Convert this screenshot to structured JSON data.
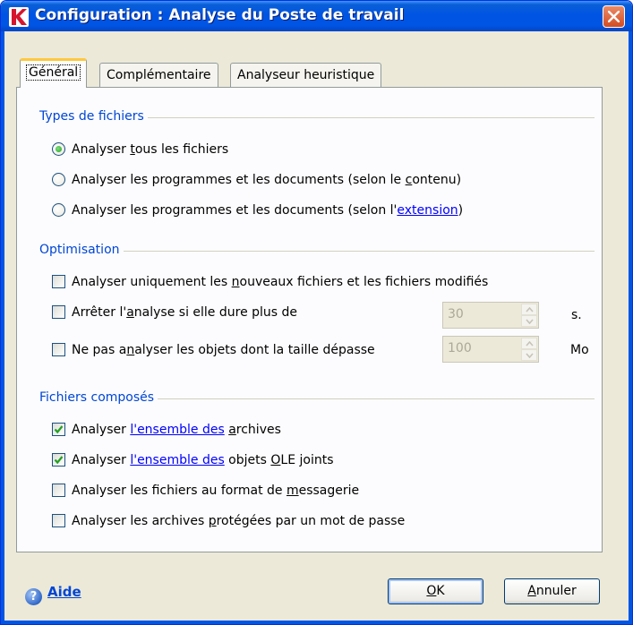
{
  "window": {
    "title": "Configuration : Analyse du Poste de travail",
    "app_icon": "kaspersky-k-icon",
    "close_icon": "close-x-icon"
  },
  "tabs": [
    {
      "label": "Général",
      "active": true
    },
    {
      "label": "Complémentaire",
      "active": false
    },
    {
      "label": "Analyseur heuristique",
      "active": false
    }
  ],
  "file_types": {
    "title": "Types de fichiers",
    "options": [
      {
        "pre": "Analyser ",
        "u": "t",
        "post": "ous les fichiers",
        "selected": true
      },
      {
        "pre": "Analyser les programmes et les documents (selon le ",
        "u": "c",
        "post": "ontenu)",
        "selected": false
      },
      {
        "pre": "Analyser les programmes et les documents (selon l'",
        "link": "extension",
        "post": ")",
        "selected": false
      }
    ]
  },
  "optimisation": {
    "title": "Optimisation",
    "new_files": {
      "pre": "Analyser uniquement les ",
      "u": "n",
      "post": "ouveaux fichiers et les fichiers modifiés",
      "checked": false
    },
    "stop_duration": {
      "pre": "Arrêter l'",
      "u": "a",
      "post": "nalyse si elle dure plus de",
      "checked": false,
      "value": "30",
      "unit": "s."
    },
    "max_size": {
      "pre": "Ne pas a",
      "u": "n",
      "post": "alyser les objets dont la taille dépasse",
      "checked": false,
      "value": "100",
      "unit": "Mo"
    }
  },
  "compound": {
    "title": "Fichiers composés",
    "archives": {
      "pre": "Analyser ",
      "link": "l'ensemble des",
      "mid": " ",
      "u": "a",
      "post": "rchives",
      "checked": true
    },
    "ole": {
      "pre": "Analyser ",
      "link": "l'ensemble des",
      "mid": " objets ",
      "u": "O",
      "post": "LE joints",
      "checked": true
    },
    "mail": {
      "pre": "Analyser les fichiers au format de ",
      "u": "m",
      "post": "essagerie",
      "checked": false
    },
    "protected": {
      "pre": "Analyser les archives ",
      "u": "p",
      "post": "rotégées par un mot de passe",
      "checked": false
    }
  },
  "footer": {
    "help_label": "Aide",
    "ok_u": "O",
    "ok_rest": "K",
    "cancel_u": "A",
    "cancel_rest": "nnuler"
  },
  "colors": {
    "titlebar": "#0055E5",
    "dialog_bg": "#ECE9D8",
    "group_title": "#0046D5",
    "link": "#0000FF",
    "check_mark": "#21A121"
  }
}
